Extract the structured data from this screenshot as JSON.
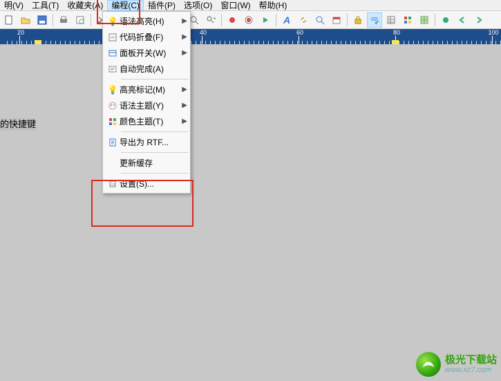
{
  "menubar": {
    "items": [
      {
        "label": "明(V)"
      },
      {
        "label": "工具(T)"
      },
      {
        "label": "收藏夹(A)"
      },
      {
        "label": "编程(C)",
        "active": true
      },
      {
        "label": "插件(P)"
      },
      {
        "label": "选项(O)"
      },
      {
        "label": "窗口(W)"
      },
      {
        "label": "帮助(H)"
      }
    ]
  },
  "ruler": {
    "numbers": [
      20,
      20,
      40,
      60,
      80,
      100
    ]
  },
  "editor": {
    "hint": "的快捷键"
  },
  "dropdown": {
    "groups": [
      [
        {
          "icon": "bulb",
          "label": "语法高亮(H)",
          "submenu": true
        },
        {
          "icon": "fold",
          "label": "代码折叠(F)",
          "submenu": true
        },
        {
          "icon": "panel",
          "label": "面板开关(W)",
          "submenu": true
        },
        {
          "icon": "auto",
          "label": "自动完成(A)"
        }
      ],
      [
        {
          "icon": "bulb2",
          "label": "高亮标记(M)",
          "submenu": true
        },
        {
          "icon": "theme",
          "label": "语法主题(Y)",
          "submenu": true
        },
        {
          "icon": "color",
          "label": "颜色主题(T)",
          "submenu": true
        }
      ],
      [
        {
          "icon": "rtf",
          "label": "导出为 RTF..."
        }
      ],
      [
        {
          "icon": "",
          "label": "更新缓存"
        }
      ],
      [
        {
          "icon": "settings",
          "label": "设置(S)..."
        }
      ]
    ]
  },
  "watermark": {
    "name": "极光下载站",
    "url": "www.xz7.com"
  }
}
